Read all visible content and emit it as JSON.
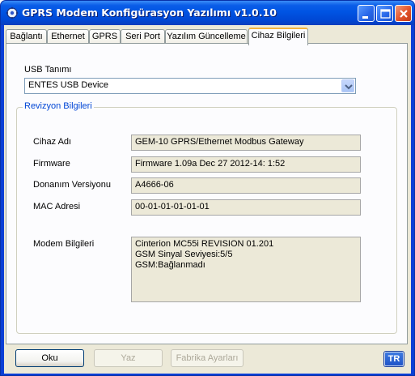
{
  "window": {
    "title": "GPRS Modem Konfigürasyon Yazılımı v1.0.10"
  },
  "tabs": [
    {
      "label": "Bağlantı"
    },
    {
      "label": "Ethernet"
    },
    {
      "label": "GPRS"
    },
    {
      "label": "Seri Port"
    },
    {
      "label": "Yazılım Güncelleme"
    },
    {
      "label": "Cihaz Bilgileri"
    }
  ],
  "active_tab": "Cihaz Bilgileri",
  "usb": {
    "label": "USB Tanımı",
    "selected": "ENTES USB Device"
  },
  "revision": {
    "group_title": "Revizyon Bilgileri",
    "device_name_label": "Cihaz Adı",
    "device_name_value": "GEM-10 GPRS/Ethernet Modbus Gateway",
    "firmware_label": "Firmware",
    "firmware_value": "Firmware 1.09a  Dec 27 2012-14: 1:52",
    "hardware_label": "Donanım Versiyonu",
    "hardware_value": "A4666-06",
    "mac_label": "MAC Adresi",
    "mac_value": "00-01-01-01-01-01",
    "modem_label": "Modem Bilgileri",
    "modem_lines": [
      "Cinterion MC55i REVISION 01.201",
      "GSM Sinyal Seviyesi:5/5",
      "GSM:Bağlanmadı"
    ]
  },
  "buttons": {
    "read": "Oku",
    "write": "Yaz",
    "factory": "Fabrika Ayarları",
    "language": "TR"
  },
  "icons": {
    "app": "gear-network-icon",
    "minimize": "minimize-icon",
    "maximize": "maximize-icon",
    "close": "close-icon",
    "dropdown": "chevron-down-icon"
  },
  "colors": {
    "titlebar": "#0054e3",
    "group_title": "#0046d5",
    "active_tab_accent": "#f6b43c"
  }
}
